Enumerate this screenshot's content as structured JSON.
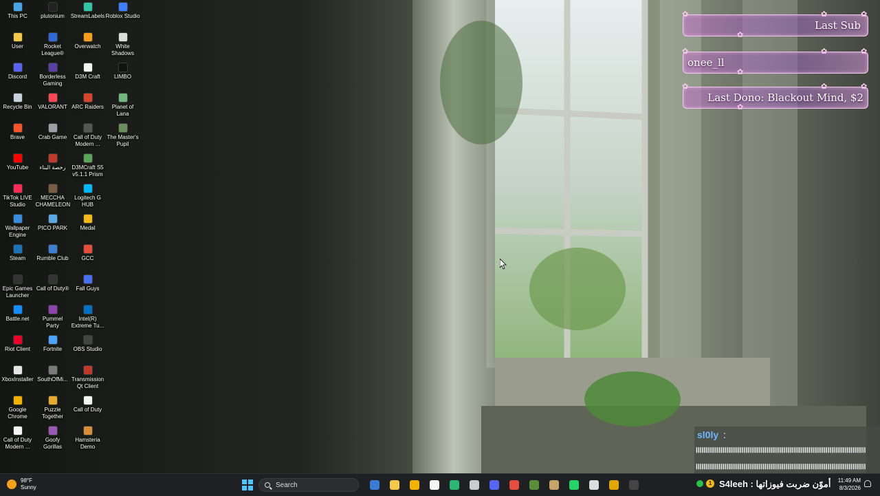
{
  "desktop": {
    "columns": [
      [
        {
          "label": "This PC",
          "icon": "computer-icon",
          "color": "#4aa3e8"
        },
        {
          "label": "User",
          "icon": "folder-icon",
          "color": "#f3c84b"
        },
        {
          "label": "Discord",
          "icon": "discord-icon",
          "color": "#5865f2"
        },
        {
          "label": "Recycle Bin",
          "icon": "recycle-bin-icon",
          "color": "#c7d3dc"
        },
        {
          "label": "Brave",
          "icon": "brave-icon",
          "color": "#fb542b"
        },
        {
          "label": "YouTube",
          "icon": "youtube-icon",
          "color": "#ff0000"
        },
        {
          "label": "TikTok LIVE Studio",
          "icon": "tiktok-icon",
          "color": "#fe2c55"
        },
        {
          "label": "Wallpaper Engine",
          "icon": "wallpaper-engine-icon",
          "color": "#3a8dde"
        },
        {
          "label": "Steam",
          "icon": "steam-icon",
          "color": "#1b73b8"
        },
        {
          "label": "Epic Games Launcher",
          "icon": "epic-games-icon",
          "color": "#333333"
        },
        {
          "label": "Battle.net",
          "icon": "battlenet-icon",
          "color": "#148eff"
        },
        {
          "label": "Riot Client",
          "icon": "riot-icon",
          "color": "#eb0029"
        },
        {
          "label": "XboxInstaller",
          "icon": "xbox-icon",
          "color": "#e6e6e6"
        },
        {
          "label": "Google Chrome",
          "icon": "chrome-icon",
          "color": "#f2b300"
        },
        {
          "label": "Call of Duty Modern ...",
          "icon": "game-shortcut-icon",
          "color": "#f5f5f5"
        }
      ],
      [
        {
          "label": "plutonium",
          "icon": "plutonium-icon",
          "color": "#222222"
        },
        {
          "label": "Rocket League®",
          "icon": "rocket-league-icon",
          "color": "#2f6ad8"
        },
        {
          "label": "Borderless Gaming",
          "icon": "borderless-gaming-icon",
          "color": "#5b3fa8"
        },
        {
          "label": "VALORANT",
          "icon": "valorant-icon",
          "color": "#ff4655"
        },
        {
          "label": "Crab Game",
          "icon": "crab-game-icon",
          "color": "#9aa0a6"
        },
        {
          "label": "رخصة البناء",
          "icon": "game-shortcut-icon",
          "color": "#c0392b"
        },
        {
          "label": "MECCHA CHAMELEON",
          "icon": "meccha-chameleon-icon",
          "color": "#7a5b44"
        },
        {
          "label": "PICO PARK",
          "icon": "pico-park-icon",
          "color": "#5aa9e6"
        },
        {
          "label": "Rumble Club",
          "icon": "rumble-club-icon",
          "color": "#3d7fd1"
        },
        {
          "label": "Call of Duty®",
          "icon": "call-of-duty-icon",
          "color": "#333333"
        },
        {
          "label": "Pummel Party",
          "icon": "pummel-party-icon",
          "color": "#8e44ad"
        },
        {
          "label": "Fortnite",
          "icon": "fortnite-icon",
          "color": "#4aa3ff"
        },
        {
          "label": "SouthOfMi...",
          "icon": "game-shortcut-icon",
          "color": "#7a7a7a"
        },
        {
          "label": "Puzzle Together",
          "icon": "puzzle-together-icon",
          "color": "#e5a92b"
        },
        {
          "label": "Goofy Gorillas",
          "icon": "goofy-gorillas-icon",
          "color": "#9b59b6"
        }
      ],
      [
        {
          "label": "StreamLabels",
          "icon": "streamlabels-icon",
          "color": "#31c3a2"
        },
        {
          "label": "Overwatch",
          "icon": "overwatch-icon",
          "color": "#f99e1a"
        },
        {
          "label": "D3M Craft",
          "icon": "file-icon",
          "color": "#f5f5f5"
        },
        {
          "label": "ARC Raiders",
          "icon": "arc-raiders-icon",
          "color": "#d9452b"
        },
        {
          "label": "Call of Duty Modern ...",
          "icon": "call-of-duty-icon",
          "color": "#555555"
        },
        {
          "label": "D3MCraft S5 v5.1.1 Prism",
          "icon": "prism-launcher-icon",
          "color": "#5aa55a"
        },
        {
          "label": "Logitech G HUB",
          "icon": "logitech-icon",
          "color": "#00b8fc"
        },
        {
          "label": "Medal",
          "icon": "medal-icon",
          "color": "#f3b818"
        },
        {
          "label": "GCC",
          "icon": "gcc-icon",
          "color": "#e74c3c"
        },
        {
          "label": "Fall Guys",
          "icon": "fall-guys-icon",
          "color": "#4a6ff0"
        },
        {
          "label": "Intel(R) Extreme Tu...",
          "icon": "intel-icon",
          "color": "#0071c5"
        },
        {
          "label": "OBS Studio",
          "icon": "obs-icon",
          "color": "#444444"
        },
        {
          "label": "Transmission Qt Client",
          "icon": "transmission-icon",
          "color": "#c0392b"
        },
        {
          "label": "Call of Duty",
          "icon": "file-icon",
          "color": "#f5f5f5"
        },
        {
          "label": "Hamsteria Demo",
          "icon": "hamsteria-icon",
          "color": "#d98c3a"
        }
      ],
      [
        {
          "label": "Roblox Studio",
          "icon": "roblox-studio-icon",
          "color": "#3d7eff"
        },
        {
          "label": "White Shadows",
          "icon": "white-shadows-icon",
          "color": "#dddddd"
        },
        {
          "label": "LIMBO",
          "icon": "limbo-icon",
          "color": "#111111"
        },
        {
          "label": "Planet of Lana",
          "icon": "planet-of-lana-icon",
          "color": "#6fb77e"
        },
        {
          "label": "The Master's Pupil",
          "icon": "the-masters-pupil-icon",
          "color": "#6a8f5a"
        }
      ]
    ]
  },
  "overlay": {
    "last_sub_label": "Last Sub",
    "last_sub_name": "onee_ll",
    "last_dono": "Last Dono: Blackout Mind, $2",
    "chat_user": "sl0ly",
    "chat_colon": ":",
    "chat_line_1": "ااااااااااااااااااااااااااااااااااااااااااااااااااااااااااااااااااااااااااااااااااااااااا",
    "chat_line_2": "ااااااااااااااااااااااااااااااااااااااااااااااااااااااااااااااااااااااااااااااااااااااااا",
    "chat_bottom": "S4leeh : أموّن ضربت فيوزاتها"
  },
  "taskbar": {
    "weather_temp": "98°F",
    "weather_desc": "Sunny",
    "search_placeholder": "Search",
    "pinned": [
      {
        "name": "widgets-icon",
        "color": "#3a7bd5"
      },
      {
        "name": "file-explorer-icon",
        "color": "#f3c84b"
      },
      {
        "name": "chrome-icon",
        "color": "#f2b300"
      },
      {
        "name": "file-icon",
        "color": "#f5f5f5"
      },
      {
        "name": "edge-icon",
        "color": "#2bb673"
      },
      {
        "name": "settings-icon",
        "color": "#cccccc"
      },
      {
        "name": "discord-icon",
        "color": "#5865f2"
      },
      {
        "name": "timer-icon",
        "color": "#e74c3c"
      },
      {
        "name": "minecraft-icon",
        "color": "#5a8f3a"
      },
      {
        "name": "box-icon",
        "color": "#c8a36a"
      },
      {
        "name": "whatsapp-icon",
        "color": "#25d366"
      },
      {
        "name": "game-controller-icon",
        "color": "#dddddd"
      },
      {
        "name": "chrome-canary-icon",
        "color": "#e0a800"
      },
      {
        "name": "epic-games-icon",
        "color": "#444444"
      }
    ],
    "badge": "1",
    "time": "11:49 AM",
    "date": "8/3/2026"
  }
}
